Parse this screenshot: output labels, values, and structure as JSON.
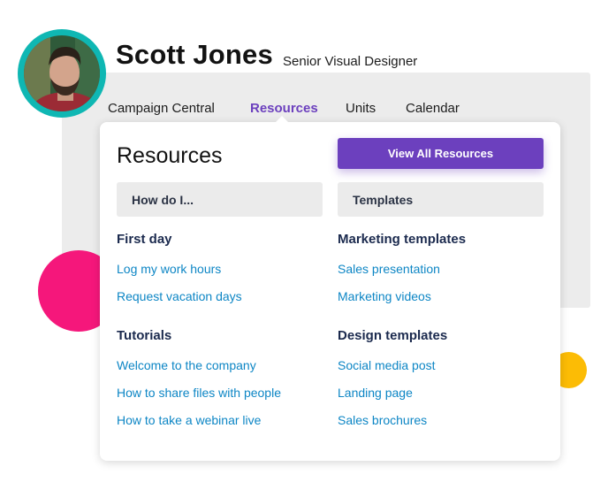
{
  "profile": {
    "name": "Scott Jones",
    "title": "Senior Visual Designer"
  },
  "nav": {
    "items": [
      {
        "label": "Campaign Central",
        "active": false
      },
      {
        "label": "Resources",
        "active": true
      },
      {
        "label": "Units",
        "active": false
      },
      {
        "label": "Calendar",
        "active": false
      }
    ]
  },
  "menu": {
    "title": "Resources",
    "view_all_label": "View All Resources",
    "left_field": "How do I...",
    "right_field": "Templates",
    "sections": {
      "first_day": {
        "heading": "First day",
        "links": [
          "Log my work hours",
          "Request vacation days"
        ]
      },
      "tutorials": {
        "heading": "Tutorials",
        "links": [
          "Welcome to the company",
          "How to share files with people",
          "How to take a webinar live"
        ]
      },
      "marketing_templates": {
        "heading": "Marketing templates",
        "links": [
          "Sales presentation",
          "Marketing videos"
        ]
      },
      "design_templates": {
        "heading": "Design templates",
        "links": [
          "Social media post",
          "Landing page",
          "Sales brochures"
        ]
      }
    }
  },
  "colors": {
    "accent": "#6c40be",
    "link": "#0d86c5",
    "avatar_ring": "#0fb7b3",
    "deco_pink": "#f5177b",
    "deco_yellow": "#fcbc05"
  }
}
